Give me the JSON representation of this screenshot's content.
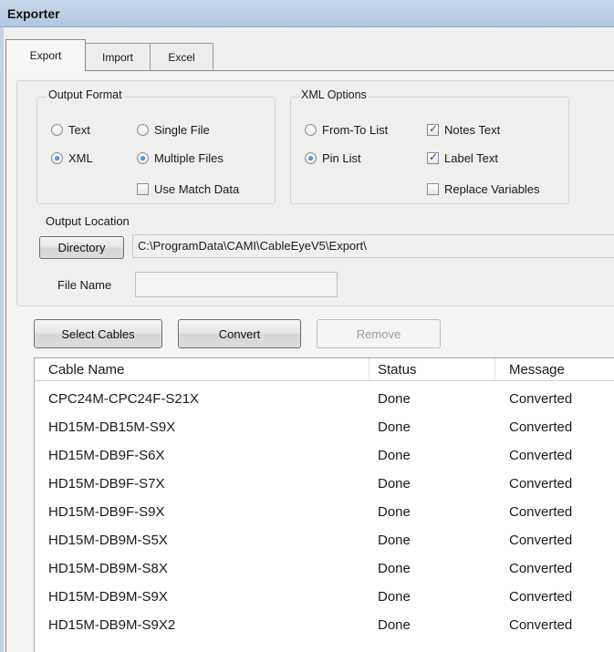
{
  "window": {
    "title": "Exporter"
  },
  "tabs": [
    {
      "label": "Export",
      "active": true
    },
    {
      "label": "Import",
      "active": false
    },
    {
      "label": "Excel",
      "active": false
    }
  ],
  "output_format": {
    "label": "Output Format",
    "text_label": "Text",
    "xml_label": "XML",
    "single_file_label": "Single File",
    "multiple_files_label": "Multiple Files",
    "use_match_data_label": "Use Match Data",
    "selected_format": "XML",
    "selected_files": "Multiple Files",
    "use_match_data": false
  },
  "xml_options": {
    "label": "XML Options",
    "from_to_list_label": "From-To List",
    "pin_list_label": "Pin List",
    "notes_text_label": "Notes Text",
    "label_text_label": "Label Text",
    "replace_variables_label": "Replace Variables",
    "selected_list": "Pin List",
    "notes_text": true,
    "label_text": true,
    "replace_variables": false
  },
  "output_location": {
    "label": "Output Location",
    "directory_button": "Directory",
    "directory_path": "C:\\ProgramData\\CAMI\\CableEyeV5\\Export\\",
    "file_name_label": "File Name",
    "file_name_value": ""
  },
  "actions": {
    "select_cables": "Select Cables",
    "convert": "Convert",
    "remove": "Remove"
  },
  "table": {
    "columns": [
      "Cable Name",
      "Status",
      "Message"
    ],
    "rows": [
      [
        "CPC24M-CPC24F-S21X",
        "Done",
        "Converted"
      ],
      [
        "HD15M-DB15M-S9X",
        "Done",
        "Converted"
      ],
      [
        "HD15M-DB9F-S6X",
        "Done",
        "Converted"
      ],
      [
        "HD15M-DB9F-S7X",
        "Done",
        "Converted"
      ],
      [
        "HD15M-DB9F-S9X",
        "Done",
        "Converted"
      ],
      [
        "HD15M-DB9M-S5X",
        "Done",
        "Converted"
      ],
      [
        "HD15M-DB9M-S8X",
        "Done",
        "Converted"
      ],
      [
        "HD15M-DB9M-S9X",
        "Done",
        "Converted"
      ],
      [
        "HD15M-DB9M-S9X2",
        "Done",
        "Converted"
      ]
    ]
  }
}
